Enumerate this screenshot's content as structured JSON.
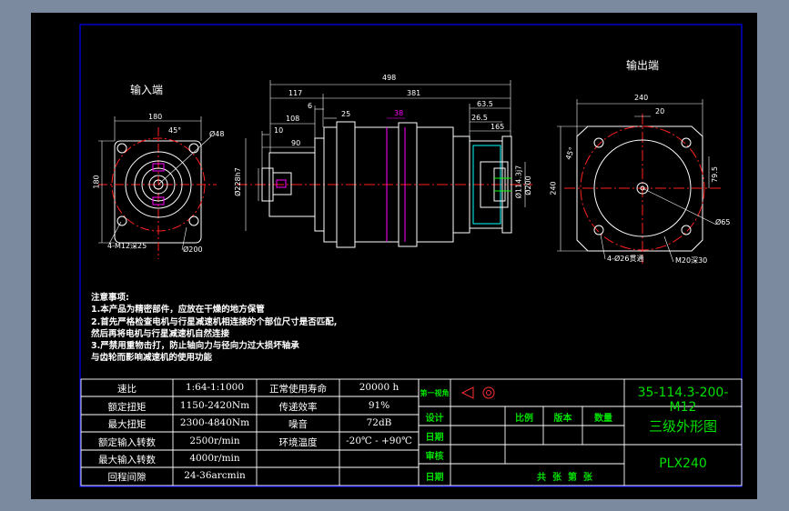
{
  "views": {
    "input_end_title": "输入端",
    "output_end_title": "输出端"
  },
  "dimensions": {
    "input": {
      "d180_top": "180",
      "d180_side": "180",
      "phi48": "Ø48",
      "angle45": "45°",
      "thread": "4-M12深25",
      "phi200": "Ø200"
    },
    "front": {
      "d498": "498",
      "d117": "117",
      "d381": "381",
      "d6": "6",
      "d108": "108",
      "d25": "25",
      "d38": "38",
      "d63_5": "63.5",
      "d26_5": "26.5",
      "d165": "165",
      "d10": "10",
      "d90": "90",
      "phi228": "Ø228h7",
      "phi114": "Ø114.3j7",
      "phi200v": "Ø200"
    },
    "output": {
      "d240_top": "240",
      "d20": "20",
      "angle45": "45°",
      "d240_side": "240",
      "d79_5": "79.5",
      "phi65": "Ø65",
      "holes": "4-Ø26贯通",
      "m20": "M20深30"
    }
  },
  "notes": {
    "title": "注意事项:",
    "lines": [
      "1.本产品为精密部件，应放在干燥的地方保管",
      "2.首先严格检查电机与行星减速机相连接的个部位尺寸是否匹配,",
      "然后再将电机与行星减速机自然连接",
      "3.严禁用重物击打，防止轴向力与径向力过大损坏轴承",
      "与齿轮而影响减速机的使用功能"
    ]
  },
  "spec_table": {
    "rows": [
      {
        "label": "速比",
        "value": "1:64-1:1000",
        "label2": "正常使用寿命",
        "value2": "20000 h"
      },
      {
        "label": "额定扭矩",
        "value": "1150-2420Nm",
        "label2": "传递效率",
        "value2": "91%"
      },
      {
        "label": "最大扭矩",
        "value": "2300-4840Nm",
        "label2": "噪音",
        "value2": "72dB"
      },
      {
        "label": "额定输入转数",
        "value": "2500r/min",
        "label2": "环境温度",
        "value2": "-20℃ - +90℃"
      },
      {
        "label": "最大输入转数",
        "value": "4000r/min",
        "label2": "",
        "value2": ""
      },
      {
        "label": "回程间隙",
        "value": "24-36arcmin",
        "label2": "",
        "value2": ""
      }
    ]
  },
  "title_block": {
    "projection": "第一视角",
    "code": "35-114.3-200-M12",
    "design": "设计",
    "ratio": "比例",
    "version": "版本",
    "quantity": "数量",
    "date1": "日期",
    "drawing_name": "三级外形图",
    "review": "审核",
    "date2": "日期",
    "sheets": "共  张  第  张",
    "model": "PLX240"
  },
  "colors": {
    "background": "#7b8a9e",
    "sheet": "#000000",
    "outline": "#ffffff",
    "frame": "#0000ff",
    "centerline": "#ff0000",
    "dimension": "#ffffff",
    "title_text": "#00e000"
  }
}
